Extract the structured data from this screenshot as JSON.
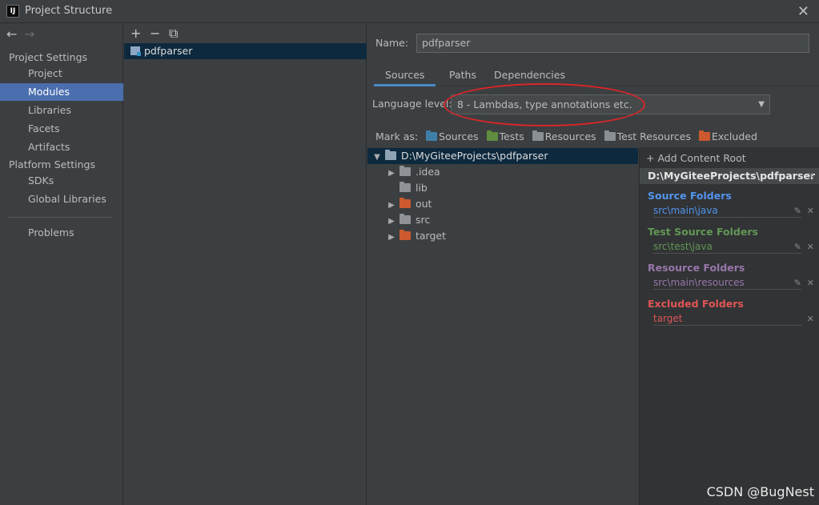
{
  "window": {
    "title": "Project Structure",
    "app_icon_text": "IJ"
  },
  "nav": {
    "back": "←",
    "forward": "→",
    "project_settings_label": "Project Settings",
    "platform_settings_label": "Platform Settings",
    "items": {
      "project": "Project",
      "modules": "Modules",
      "libraries": "Libraries",
      "facets": "Facets",
      "artifacts": "Artifacts",
      "sdks": "SDKs",
      "global_libraries": "Global Libraries",
      "problems": "Problems"
    },
    "selected": "Modules"
  },
  "modules_panel": {
    "toolbar": {
      "add": "+",
      "remove": "−",
      "copy": "⧉"
    },
    "module_name": "pdfparser"
  },
  "detail": {
    "name_label": "Name:",
    "name_value": "pdfparser",
    "tabs": {
      "sources": "Sources",
      "paths": "Paths",
      "dependencies": "Dependencies"
    },
    "active_tab": "Sources",
    "language_level_label": "Language level:",
    "language_level_value": "8 - Lambdas, type annotations etc.",
    "mark_as_label": "Mark as:",
    "mark_as": {
      "sources": "Sources",
      "tests": "Tests",
      "resources": "Resources",
      "test_resources": "Test Resources",
      "excluded": "Excluded"
    }
  },
  "tree": {
    "root": "D:\\MyGiteeProjects\\pdfparser",
    "children": {
      "idea": ".idea",
      "lib": "lib",
      "out": "out",
      "src": "src",
      "target": "target"
    }
  },
  "roots_panel": {
    "add_content_root": "Add Content Root",
    "root_path": "D:\\MyGiteeProjects\\pdfparser",
    "source_folders": {
      "title": "Source Folders",
      "path": "src\\main\\java",
      "color": "#5394ec"
    },
    "test_source_folders": {
      "title": "Test Source Folders",
      "path": "src\\test\\java",
      "color": "#629755"
    },
    "resource_folders": {
      "title": "Resource Folders",
      "path": "src\\main\\resources",
      "color": "#9876aa"
    },
    "excluded_folders": {
      "title": "Excluded Folders",
      "path": "target",
      "color": "#e05555"
    }
  },
  "watermark": "CSDN @BugNest",
  "colors": {
    "accent": "#4b6eaf",
    "annotation_red": "#d8262a"
  }
}
